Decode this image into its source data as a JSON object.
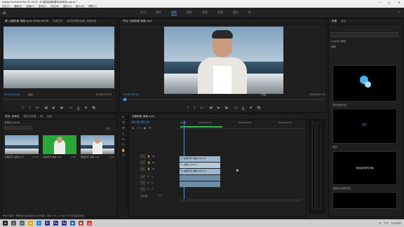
{
  "app": {
    "title": "Adobe Premiere Pro CC 2019 - E:\\影视后期\\素材\\未命名.prproj *",
    "window_controls": [
      "—",
      "▢",
      "✕"
    ]
  },
  "menu": [
    "文件(F)",
    "编辑(E)",
    "剪辑(C)",
    "序列(S)",
    "标记(M)",
    "图形(G)",
    "窗口(W)",
    "帮助(H)"
  ],
  "workspaces": {
    "tabs": [
      "学习",
      "组件",
      "编辑",
      "颜色",
      "效果",
      "音频",
      "图形",
      "库"
    ],
    "active": "编辑",
    "menu_icon": "»"
  },
  "source_panel": {
    "tabs": [
      "源: 丝路风景 海滩.mp4: 00:00:00:00",
      "效果控件",
      "音频剪辑混合器: 丝路风景"
    ],
    "timecode_left": "00:00:00:00",
    "zoom": "适合",
    "timecode_right": "00:00:07:13"
  },
  "program_panel": {
    "tabs": [
      "节目: 丝路风景 海滩.mp4"
    ],
    "timecode_left": "00:00:00:24",
    "zoom": "完整",
    "timecode_right": "00:00:07:13"
  },
  "transport_icons": [
    "{",
    "}",
    "|←",
    "◀|",
    "▶",
    "|▶",
    "→|",
    "⎙",
    "⊞",
    "📷"
  ],
  "project_panel": {
    "tabs": [
      "项目: 未命名",
      "媒体浏览器",
      "库",
      "信息"
    ],
    "path": "未命名.prproj",
    "item_count": "3 项",
    "items": [
      {
        "name": "丝路风景 海滩.mp4",
        "dur": "14:18"
      },
      {
        "name": "丝路风景 海滩.mp4",
        "dur": "7:13"
      },
      {
        "name": "丝路风景 海滩.mp4",
        "dur": "4:23"
      }
    ]
  },
  "timeline": {
    "tab": "丝路风景 海滩.mp4",
    "timecode": "00:00:00:24",
    "ruler": [
      "00:00",
      "00:00:05:00",
      "00:00:10:00",
      "00:00:15:00"
    ],
    "tracks": [
      {
        "id": "V3",
        "kind": "video"
      },
      {
        "id": "V2",
        "kind": "video"
      },
      {
        "id": "V1",
        "kind": "video"
      },
      {
        "id": "A1",
        "kind": "audio"
      },
      {
        "id": "A2",
        "kind": "audio"
      },
      {
        "id": "A3",
        "kind": "audio"
      }
    ],
    "master": "主声道",
    "master_val": "0.0",
    "clips": [
      {
        "track": "V3",
        "label": "fx 丝路风景 海滩.mp4 [V]"
      },
      {
        "track": "V2",
        "label": "fx 海滩.mp4 [V]"
      },
      {
        "track": "V1",
        "label": "fx 丝路风景 海滩.mp4 [V]"
      }
    ]
  },
  "right_panel": {
    "tabs": [
      "效果",
      "标记"
    ],
    "search_placeholder": "",
    "presets": [
      "Lumetri 预设",
      "音频"
    ],
    "cards": [
      {
        "label": "",
        "caption": "浏览最新内容"
      },
      {
        "label": "发布",
        "caption": "浏览"
      },
      {
        "label": "添加素材到时间轴",
        "caption": "查看旨在帮助您的"
      }
    ]
  },
  "status_text": "单击以选择，或单击空白处并拖动以进行框选。使用 Shift、Alt 和 Ctrl 可获得其他选项。",
  "taskbar": {
    "clock_time": "下午",
    "clock_date": "2019/6/5",
    "lang": "中"
  },
  "colors": {
    "accent": "#3e9bf2",
    "panel_bg": "#1f1f1f",
    "video_clip": "#9fb7cc",
    "audio_clip": "#6d8ea8"
  }
}
